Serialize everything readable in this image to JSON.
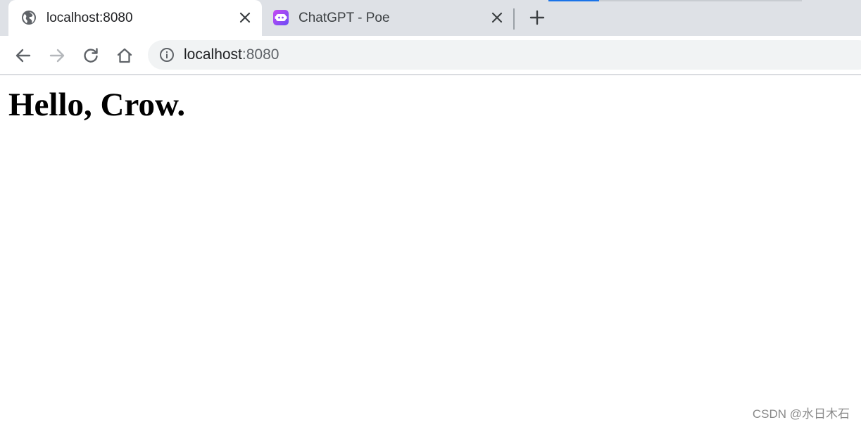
{
  "tabs": [
    {
      "title": "localhost:8080",
      "icon": "globe-icon",
      "active": true
    },
    {
      "title": "ChatGPT - Poe",
      "icon": "poe-bot-icon",
      "active": false
    }
  ],
  "toolbar": {
    "url_host": "localhost",
    "url_port": ":8080"
  },
  "page": {
    "heading": "Hello, Crow."
  },
  "watermark": "CSDN @水日木石",
  "colors": {
    "tabstrip": "#dee1e6",
    "omnibox": "#f1f3f4",
    "accent": "#1a73e8",
    "poe_gradient_start": "#c84bf2",
    "poe_gradient_end": "#6a4bf6"
  }
}
